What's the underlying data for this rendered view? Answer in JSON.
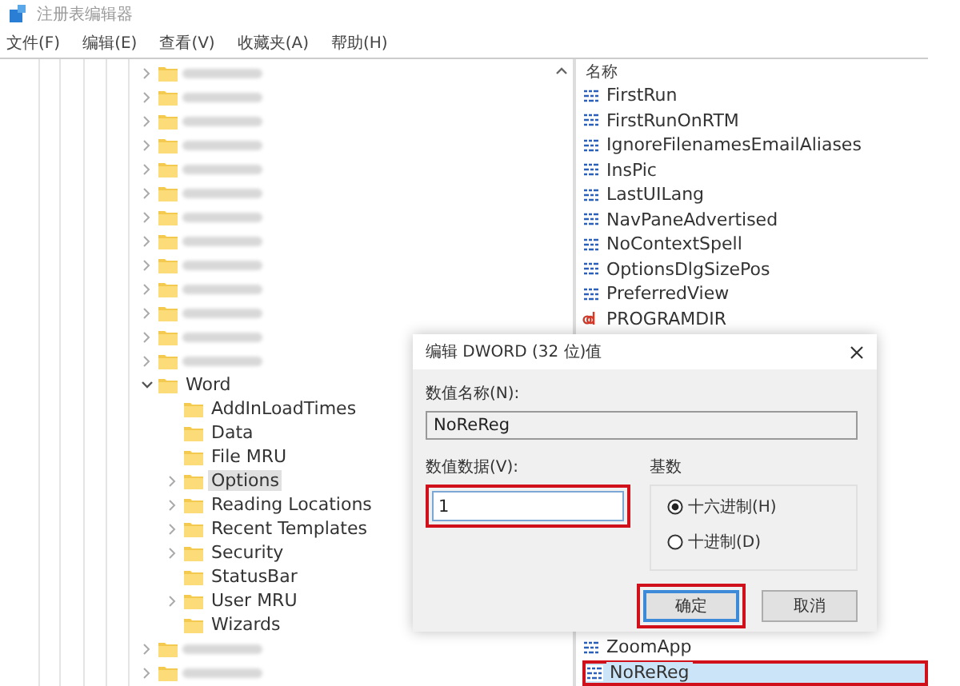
{
  "window": {
    "title": "注册表编辑器"
  },
  "menu": [
    {
      "label": "文件(F)"
    },
    {
      "label": "编辑(E)"
    },
    {
      "label": "查看(V)"
    },
    {
      "label": "收藏夹(A)"
    },
    {
      "label": "帮助(H)"
    }
  ],
  "tree": {
    "items": [
      {
        "kind": "blurred",
        "expandable": true
      },
      {
        "kind": "blurred",
        "expandable": true
      },
      {
        "kind": "blurred",
        "expandable": true
      },
      {
        "kind": "blurred",
        "expandable": true
      },
      {
        "kind": "blurred",
        "expandable": true
      },
      {
        "kind": "blurred",
        "expandable": true
      },
      {
        "kind": "blurred",
        "expandable": true
      },
      {
        "kind": "blurred",
        "expandable": true
      },
      {
        "kind": "blurred",
        "expandable": true
      },
      {
        "kind": "blurred",
        "expandable": true
      },
      {
        "kind": "blurred",
        "expandable": true
      },
      {
        "kind": "blurred",
        "expandable": true
      },
      {
        "kind": "blurred",
        "expandable": true
      },
      {
        "kind": "key",
        "label": "Word",
        "expanded": true,
        "selected": false,
        "children": [
          {
            "kind": "key",
            "label": "AddInLoadTimes",
            "expandable": false,
            "selected": false
          },
          {
            "kind": "key",
            "label": "Data",
            "expandable": false,
            "selected": false
          },
          {
            "kind": "key",
            "label": "File MRU",
            "expandable": false,
            "selected": false
          },
          {
            "kind": "key",
            "label": "Options",
            "expandable": true,
            "selected": true
          },
          {
            "kind": "key",
            "label": "Reading Locations",
            "expandable": true,
            "selected": false
          },
          {
            "kind": "key",
            "label": "Recent Templates",
            "expandable": true,
            "selected": false
          },
          {
            "kind": "key",
            "label": "Security",
            "expandable": true,
            "selected": false
          },
          {
            "kind": "key",
            "label": "StatusBar",
            "expandable": false,
            "selected": false
          },
          {
            "kind": "key",
            "label": "User MRU",
            "expandable": true,
            "selected": false
          },
          {
            "kind": "key",
            "label": "Wizards",
            "expandable": false,
            "selected": false
          }
        ]
      },
      {
        "kind": "blurred",
        "expandable": true
      },
      {
        "kind": "blurred",
        "expandable": true
      }
    ]
  },
  "values": {
    "header": "名称",
    "items": [
      {
        "kind": "dword",
        "name": "FirstRun",
        "selected": false
      },
      {
        "kind": "dword",
        "name": "FirstRunOnRTM",
        "selected": false
      },
      {
        "kind": "dword",
        "name": "IgnoreFilenamesEmailAliases",
        "selected": false
      },
      {
        "kind": "dword",
        "name": "InsPic",
        "selected": false
      },
      {
        "kind": "dword",
        "name": "LastUILang",
        "selected": false
      },
      {
        "kind": "dword",
        "name": "NavPaneAdvertised",
        "selected": false
      },
      {
        "kind": "dword",
        "name": "NoContextSpell",
        "selected": false
      },
      {
        "kind": "dword",
        "name": "OptionsDlgSizePos",
        "selected": false
      },
      {
        "kind": "dword",
        "name": "PreferredView",
        "selected": false
      },
      {
        "kind": "string",
        "name": "PROGRAMDIR",
        "selected": false
      },
      {
        "kind": "gap"
      },
      {
        "kind": "dword",
        "name": "ZoomApp",
        "selected": false
      },
      {
        "kind": "dword",
        "name": "NoReReg",
        "selected": true,
        "highlighted": true
      }
    ]
  },
  "dialog": {
    "title": "编辑 DWORD (32 位)值",
    "name_label": "数值名称(N):",
    "name_value": "NoReReg",
    "data_label": "数值数据(V):",
    "data_value": "1",
    "data_highlighted": true,
    "radix": {
      "label": "基数",
      "options": [
        {
          "label": "十六进制(H)",
          "selected": true
        },
        {
          "label": "十进制(D)",
          "selected": false
        }
      ]
    },
    "buttons": [
      {
        "label": "确定",
        "default": true,
        "highlighted": true
      },
      {
        "label": "取消",
        "default": false,
        "highlighted": false
      }
    ]
  }
}
